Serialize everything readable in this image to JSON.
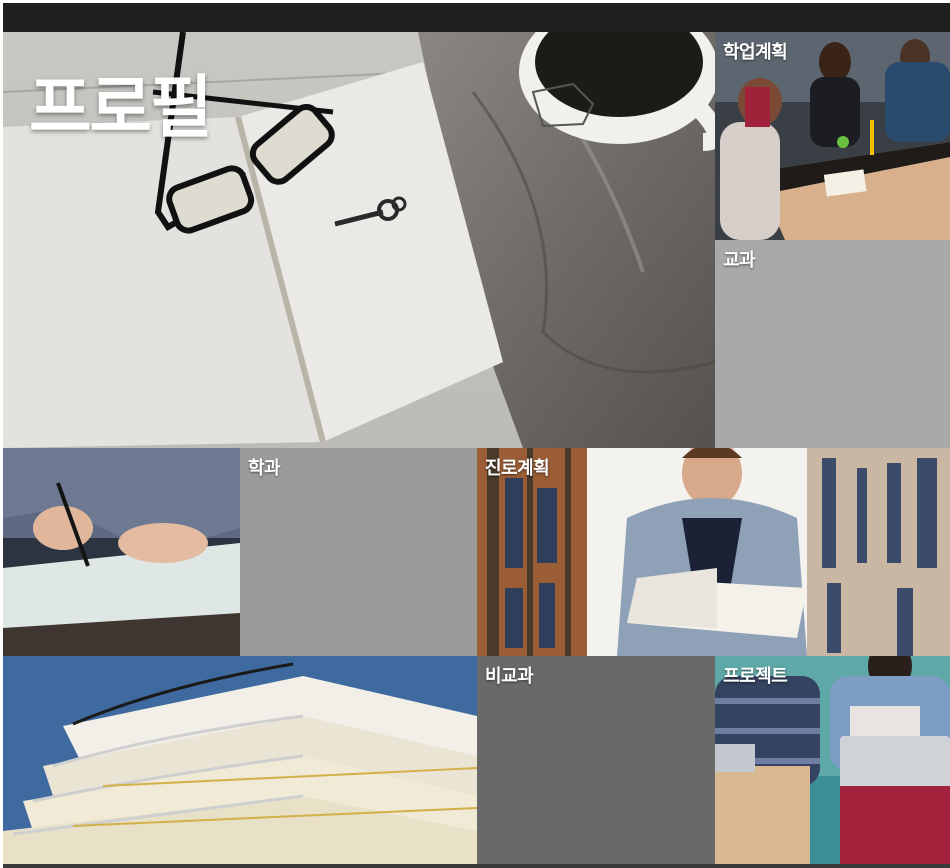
{
  "tiles": {
    "profile": {
      "label": "프로필"
    },
    "study_plan": {
      "label": "학업계획"
    },
    "subjects": {
      "label": "교과"
    },
    "department": {
      "label": "학과"
    },
    "career_plan": {
      "label": "진로계획"
    },
    "extracurricular": {
      "label": "비교과"
    },
    "project": {
      "label": "프로젝트"
    }
  },
  "colors": {
    "topbar": "#1f1f1f",
    "subjects_bg": "#a9a9a9",
    "department_bg": "#9b9b9b",
    "extracurricular_bg": "#696969"
  }
}
